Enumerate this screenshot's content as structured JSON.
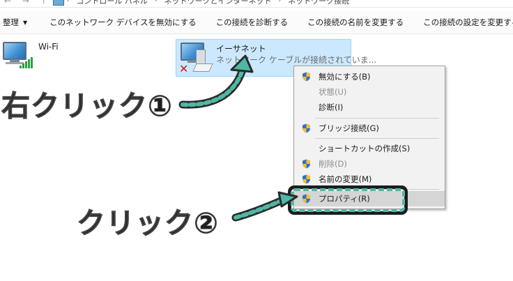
{
  "breadcrumb": {
    "nav_arrows": "← → ↑",
    "items": [
      "コントロール パネル",
      "ネットワークとインターネット",
      "ネットワーク接続"
    ]
  },
  "toolbar": {
    "organize": "整理",
    "disable_device": "このネットワーク デバイスを無効にする",
    "diagnose": "この接続を診断する",
    "rename": "この接続の名前を変更する",
    "change_settings": "この接続の設定を変更する"
  },
  "adapters": {
    "wifi": {
      "name": "Wi-Fi"
    },
    "ethernet": {
      "name": "イーサネット",
      "status": "ネットワーク ケーブルが接続されていま..."
    }
  },
  "context_menu": {
    "items": [
      {
        "label": "無効にする(B)",
        "shield": true,
        "disabled": false
      },
      {
        "label": "状態(U)",
        "shield": false,
        "disabled": true
      },
      {
        "label": "診断(I)",
        "shield": false,
        "disabled": false
      },
      {
        "label": "ブリッジ接続(G)",
        "shield": true,
        "disabled": false
      },
      {
        "label": "ショートカットの作成(S)",
        "shield": false,
        "disabled": false
      },
      {
        "label": "削除(D)",
        "shield": true,
        "disabled": true
      },
      {
        "label": "名前の変更(M)",
        "shield": true,
        "disabled": false
      },
      {
        "label": "プロパティ(R)",
        "shield": true,
        "disabled": false,
        "highlighted": true
      }
    ]
  },
  "annotations": {
    "right_click": "右クリック①",
    "click": "クリック②"
  },
  "colors": {
    "selection_bg": "#cce8ff",
    "arrow_teal": "#4fb8a4",
    "arrow_dark": "#2a2a2a",
    "shield_blue": "#2f6fcf",
    "shield_yellow": "#f2c12e"
  }
}
